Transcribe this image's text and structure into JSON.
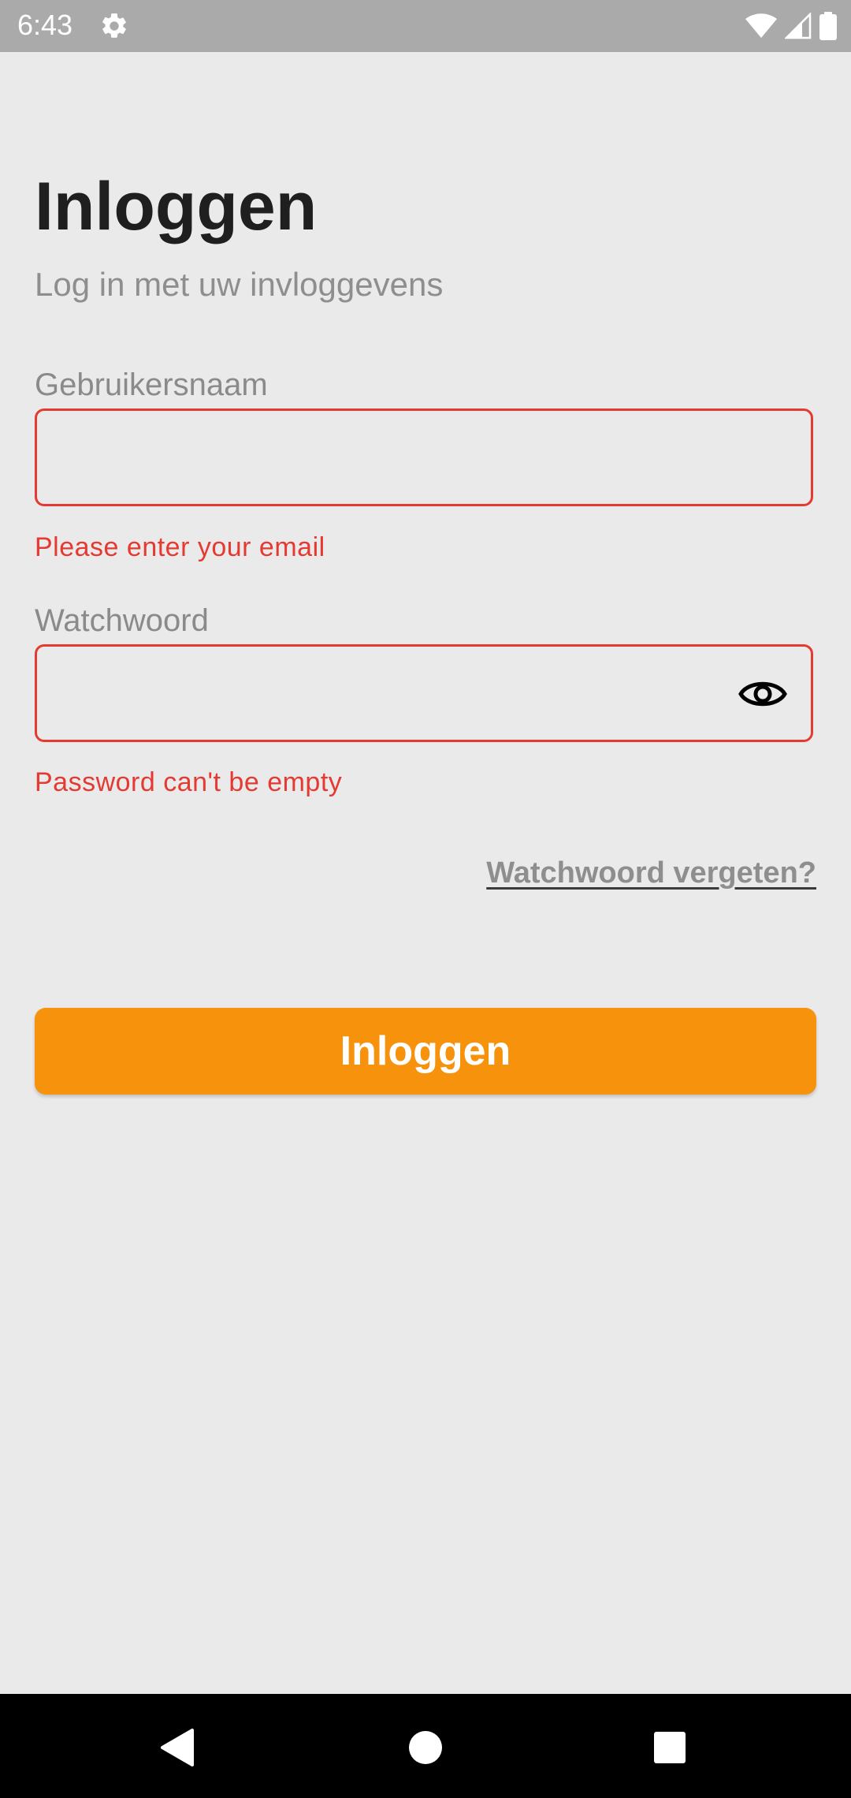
{
  "status_bar": {
    "time": "6:43",
    "icons": [
      "settings-icon",
      "wifi-icon",
      "signal-icon",
      "battery-icon"
    ]
  },
  "login": {
    "title": "Inloggen",
    "subtitle": "Log in met uw invloggevens",
    "username": {
      "label": "Gebruikersnaam",
      "value": "",
      "placeholder": "",
      "error": "Please enter your email"
    },
    "password": {
      "label": "Watchwoord",
      "value": "",
      "placeholder": "",
      "error": "Password can't be empty",
      "toggle_icon": "eye-icon"
    },
    "forgot_password": "Watchwoord vergeten?",
    "submit_label": "Inloggen"
  },
  "nav_bar": {
    "icons": [
      "back-icon",
      "home-icon",
      "recents-icon"
    ]
  },
  "colors": {
    "background": "#ebeaeb",
    "accent": "#f7920d",
    "error": "#e53a32",
    "status_bar": "#aaaaaa",
    "nav_bar": "#000000"
  }
}
